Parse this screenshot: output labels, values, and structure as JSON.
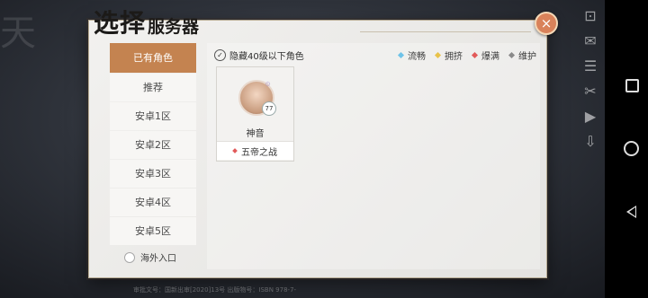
{
  "title": {
    "main": "选择",
    "sub": "服务器"
  },
  "close_icon": "×",
  "background_text": "天",
  "footer_text": "审批文号：国新出审[2020]13号 出版物号：ISBN 978-7-",
  "sidebar": {
    "tabs": [
      {
        "label": "已有角色",
        "active": true
      },
      {
        "label": "推荐"
      },
      {
        "label": "安卓1区"
      },
      {
        "label": "安卓2区"
      },
      {
        "label": "安卓3区"
      },
      {
        "label": "安卓4区"
      },
      {
        "label": "安卓5区"
      }
    ],
    "overseas_label": "海外入口"
  },
  "main": {
    "hide_low_level": {
      "label": "隐藏40级以下角色",
      "checked": true,
      "check_glyph": "✓"
    },
    "legend": [
      {
        "label": "流畅",
        "color": "#6ec3e8"
      },
      {
        "label": "拥挤",
        "color": "#e8c24a"
      },
      {
        "label": "爆满",
        "color": "#e25a5a"
      },
      {
        "label": "维护",
        "color": "#8a8a8a"
      }
    ],
    "characters": [
      {
        "name": "神音",
        "level": "77",
        "server": "五帝之战",
        "server_status_color": "#e25a5a",
        "emblem": "۞"
      }
    ]
  },
  "right_icons": [
    "⊡",
    "✉",
    "☰",
    "✂",
    "▶",
    "⇩"
  ]
}
